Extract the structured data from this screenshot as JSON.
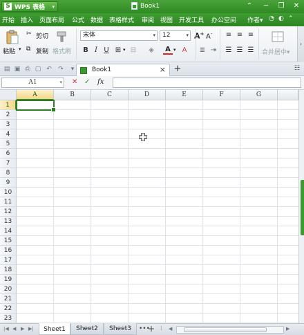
{
  "app": {
    "name": "WPS 表格",
    "logo": "S",
    "document_title": "Book1"
  },
  "menubar": {
    "items": [
      "开始",
      "插入",
      "页面布局",
      "公式",
      "数据",
      "表格样式",
      "审阅",
      "视图",
      "开发工具",
      "办公空间"
    ],
    "right_label": "作者▾"
  },
  "ribbon": {
    "paste_label": "粘贴",
    "cut_label": "剪切",
    "copy_label": "复制",
    "format_painter_label": "格式刷",
    "font_name": "宋体",
    "font_size": "12",
    "bold": "B",
    "italic": "I",
    "underline": "U",
    "merge_label": "合并居中▾"
  },
  "tabbar": {
    "tab_label": "Book1"
  },
  "formula_bar": {
    "name_box": "A1",
    "fx_label": "fx",
    "value": ""
  },
  "grid": {
    "columns": [
      "A",
      "B",
      "C",
      "D",
      "E",
      "F",
      "G"
    ],
    "rows": [
      "1",
      "2",
      "3",
      "4",
      "5",
      "6",
      "7",
      "8",
      "9",
      "10",
      "11",
      "12",
      "13",
      "14",
      "15",
      "16",
      "17",
      "18",
      "19",
      "20",
      "21",
      "22",
      "23"
    ],
    "active_cell": "A1"
  },
  "sheets": {
    "tabs": [
      "Sheet1",
      "Sheet2",
      "Sheet3"
    ],
    "active": "Sheet1",
    "more": "•••",
    "add": "+"
  },
  "colors": {
    "accent": "#2f8a23",
    "active_cell_border": "#2c7d21"
  }
}
